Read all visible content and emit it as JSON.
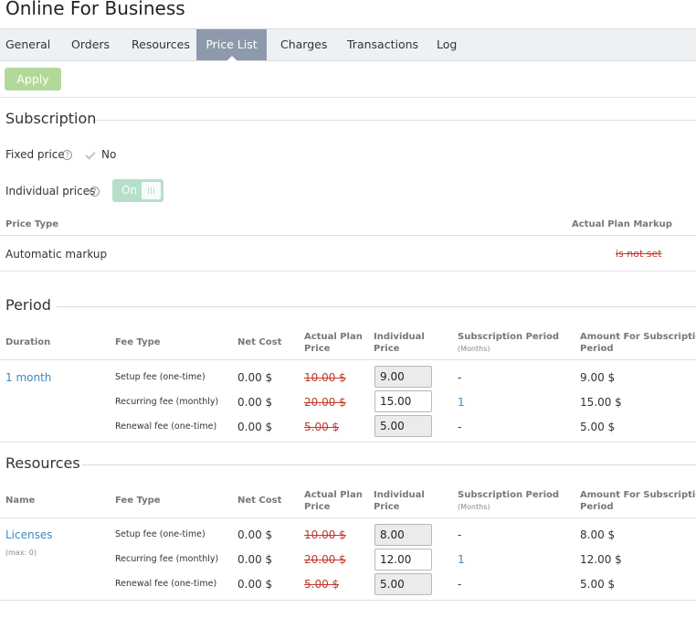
{
  "title": "Online For Business",
  "tabs": [
    {
      "label": "General"
    },
    {
      "label": "Orders"
    },
    {
      "label": "Resources"
    },
    {
      "label": "Price List"
    },
    {
      "label": "Charges"
    },
    {
      "label": "Transactions"
    },
    {
      "label": "Log"
    }
  ],
  "active_tab": "Price List",
  "toolbar": {
    "apply_label": "Apply"
  },
  "subscription": {
    "title": "Subscription",
    "fixed_price_label": "Fixed price",
    "fixed_price_value": "No",
    "individual_prices_label": "Individual prices",
    "individual_prices_toggle": "On",
    "help_glyph": "?",
    "headers": {
      "price_type": "Price Type",
      "actual_plan_markup": "Actual Plan Markup"
    },
    "row": {
      "price_type": "Automatic markup",
      "markup": "is not set"
    }
  },
  "period": {
    "title": "Period",
    "headers": {
      "first": "Duration",
      "fee_type": "Fee Type",
      "net_cost": "Net Cost",
      "actual_plan_price_1": "Actual Plan",
      "actual_plan_price_2": "Price",
      "individual_price_1": "Individual",
      "individual_price_2": "Price",
      "subscription_period": "Subscription Period",
      "subscription_period_unit": "(Months)",
      "amount_1": "Amount For Subscription",
      "amount_2": "Period"
    },
    "name": "1 month",
    "rows": [
      {
        "fee_type": "Setup fee (one-time)",
        "net_cost": "0.00 $",
        "plan_price": "10.00 $",
        "individual_price": "9.00",
        "editable": false,
        "sub_period": "-",
        "amount": "9.00 $"
      },
      {
        "fee_type": "Recurring fee (monthly)",
        "net_cost": "0.00 $",
        "plan_price": "20.00 $",
        "individual_price": "15.00",
        "editable": true,
        "sub_period": "1",
        "amount": "15.00 $"
      },
      {
        "fee_type": "Renewal fee (one-time)",
        "net_cost": "0.00 $",
        "plan_price": "5.00 $",
        "individual_price": "5.00",
        "editable": false,
        "sub_period": "-",
        "amount": "5.00 $"
      }
    ]
  },
  "resources": {
    "title": "Resources",
    "headers": {
      "first": "Name",
      "fee_type": "Fee Type",
      "net_cost": "Net Cost",
      "actual_plan_price_1": "Actual Plan",
      "actual_plan_price_2": "Price",
      "individual_price_1": "Individual",
      "individual_price_2": "Price",
      "subscription_period": "Subscription Period",
      "subscription_period_unit": "(Months)",
      "amount_1": "Amount For Subscription",
      "amount_2": "Period"
    },
    "name": "Licenses",
    "name_sub": "(max: 0)",
    "rows": [
      {
        "fee_type": "Setup fee (one-time)",
        "net_cost": "0.00 $",
        "plan_price": "10.00 $",
        "individual_price": "8.00",
        "editable": false,
        "sub_period": "-",
        "amount": "8.00 $"
      },
      {
        "fee_type": "Recurring fee (monthly)",
        "net_cost": "0.00 $",
        "plan_price": "20.00 $",
        "individual_price": "12.00",
        "editable": true,
        "sub_period": "1",
        "amount": "12.00 $"
      },
      {
        "fee_type": "Renewal fee (one-time)",
        "net_cost": "0.00 $",
        "plan_price": "5.00 $",
        "individual_price": "5.00",
        "editable": false,
        "sub_period": "-",
        "amount": "5.00 $"
      }
    ]
  }
}
